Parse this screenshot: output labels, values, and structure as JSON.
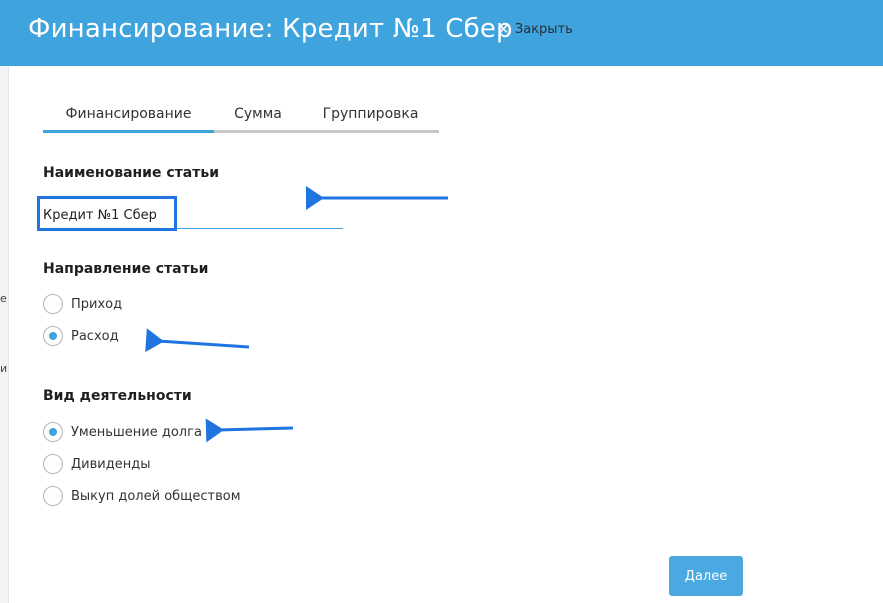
{
  "header": {
    "title": "Финансирование: Кредит №1 Сбер",
    "close_icon": "×",
    "close_label": "Закрыть"
  },
  "left_edge": {
    "chars": [
      "е",
      "и"
    ]
  },
  "tabs": [
    {
      "label": "Финансирование",
      "active": true
    },
    {
      "label": "Сумма",
      "active": false
    },
    {
      "label": "Группировка",
      "active": false
    }
  ],
  "article_name": {
    "title": "Наименование статьи",
    "value": "Кредит №1 Сбер"
  },
  "direction": {
    "title": "Направление статьи",
    "options": [
      {
        "label": "Приход",
        "checked": false
      },
      {
        "label": "Расход",
        "checked": true
      }
    ]
  },
  "activity": {
    "title": "Вид деятельности",
    "options": [
      {
        "label": "Уменьшение долга",
        "checked": true
      },
      {
        "label": "Дивиденды",
        "checked": false
      },
      {
        "label": "Выкуп долей обществом",
        "checked": false
      }
    ]
  },
  "footer": {
    "next_label": "Далее"
  },
  "colors": {
    "header_bg": "#3fa3dd",
    "accent": "#3fa3dd",
    "annotation": "#1f74e0"
  },
  "annotations": {
    "arrow_icon": "left-arrow-icon"
  }
}
